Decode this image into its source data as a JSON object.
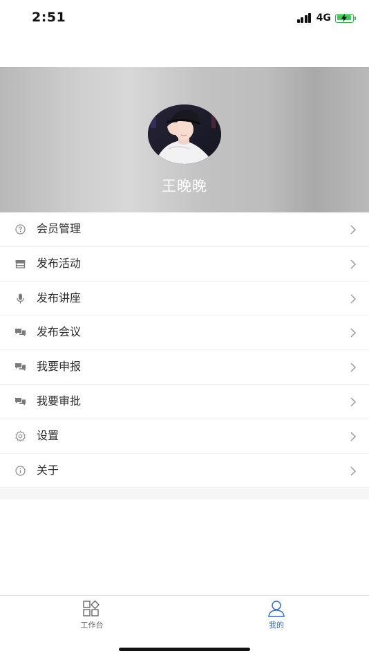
{
  "status_bar": {
    "time": "2:51",
    "network": "4G"
  },
  "profile": {
    "name": "王晚晚"
  },
  "menu": {
    "items": [
      {
        "label": "会员管理",
        "icon": "question-circle-icon"
      },
      {
        "label": "发布活动",
        "icon": "store-icon"
      },
      {
        "label": "发布讲座",
        "icon": "microphone-icon"
      },
      {
        "label": "发布会议",
        "icon": "chat-bubbles-icon"
      },
      {
        "label": "我要申报",
        "icon": "chat-bubbles-icon"
      },
      {
        "label": "我要审批",
        "icon": "chat-bubbles-icon"
      },
      {
        "label": "设置",
        "icon": "gear-icon"
      },
      {
        "label": "关于",
        "icon": "info-circle-icon"
      }
    ]
  },
  "tab_bar": {
    "tabs": [
      {
        "label": "工作台",
        "icon": "grid-icon",
        "active": false
      },
      {
        "label": "我的",
        "icon": "person-icon",
        "active": true
      }
    ]
  },
  "colors": {
    "accent": "#2f6dc9",
    "inactive": "#666666",
    "battery": "#3ec95a"
  }
}
